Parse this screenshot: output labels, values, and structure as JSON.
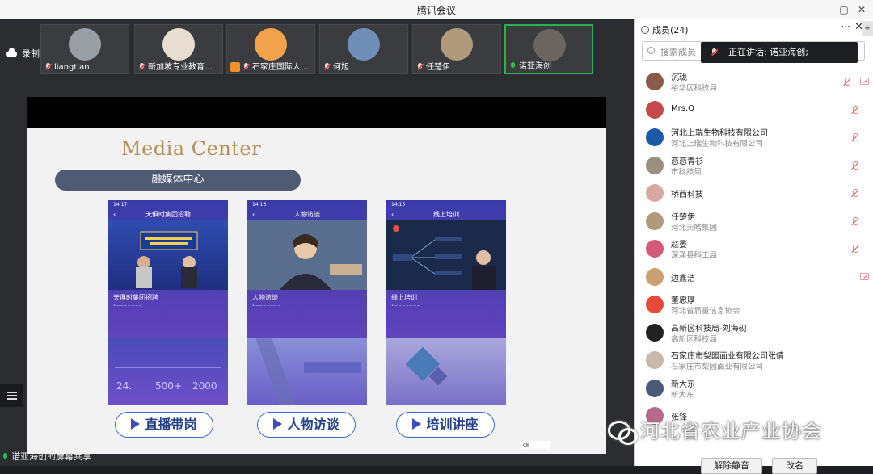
{
  "window": {
    "title": "腾讯会议",
    "controls": [
      "–",
      "▢",
      "✕"
    ]
  },
  "recording": {
    "label": "录制中"
  },
  "participants_strip": [
    {
      "name": "liangtian",
      "mic": "off",
      "avatar": "#9a9fa6"
    },
    {
      "name": "新加坡专业教育培...",
      "mic": "off",
      "avatar": "#e8ddd0"
    },
    {
      "name": "石家庄国际人才...",
      "mic": "off",
      "avatar": "#f2a24a",
      "badge": true
    },
    {
      "name": "何旭",
      "mic": "off",
      "avatar": "#6f8fb8"
    },
    {
      "name": "任楚伊",
      "mic": "off",
      "avatar": "#b09a7b"
    },
    {
      "name": "诺亚海创",
      "mic": "green",
      "avatar": "#6b6560",
      "active": true
    }
  ],
  "slide": {
    "title_en": "Media Center",
    "title_cn": "融媒体中心",
    "phones": [
      {
        "header": "天俱时集团招聘",
        "subtitle": "天俱时集团招聘",
        "time": "14:17",
        "hero": "#2d3b8f",
        "accent": "#f6d04a",
        "lower": "#4e44ba"
      },
      {
        "header": "人物访谈",
        "subtitle": "人物访谈",
        "time": "14:16",
        "hero": "#3e4d7a",
        "accent": "#ffffff",
        "lower": "#6d6fc0"
      },
      {
        "header": "线上培训",
        "subtitle": "线上培训",
        "time": "14:15",
        "hero": "#1d2e55",
        "accent": "#e74f3c",
        "lower": "#9a98d4"
      }
    ],
    "buttons": [
      "直播带岗",
      "人物访谈",
      "培训讲座"
    ]
  },
  "share": {
    "label": "诺亚海创的屏幕共享"
  },
  "ime": {
    "label": "ck"
  },
  "members_panel": {
    "header": "成员(24)",
    "more": "···",
    "close": "✕",
    "side_tab": "≡",
    "search_placeholder": "搜索成员",
    "speaking_label": "正在讲话: 诺亚海创;",
    "members": [
      {
        "name": "沉珑",
        "sub": "裕华区科技局",
        "avatar": "#8a5a4a",
        "mic": true,
        "cam": true
      },
      {
        "name": "Mrs.Q",
        "sub": "",
        "avatar": "#c54a4a",
        "mic": true,
        "cam": false
      },
      {
        "name": "河北上瑞生物科技有限公司",
        "sub": "河北上瑞生物科技有限公司",
        "avatar": "#1c5aa8",
        "mic": true,
        "cam": false
      },
      {
        "name": "恋恋青衫",
        "sub": "市科技局",
        "avatar": "#9a8f80",
        "mic": true,
        "cam": false
      },
      {
        "name": "桥西科技",
        "sub": "",
        "avatar": "#d7aaa0",
        "mic": true,
        "cam": false
      },
      {
        "name": "任楚伊",
        "sub": "河北天皓集团",
        "avatar": "#b09a7b",
        "mic": true,
        "cam": false
      },
      {
        "name": "赵晏",
        "sub": "深泽县科工局",
        "avatar": "#d45a7a",
        "mic": true,
        "cam": false
      },
      {
        "name": "边鑫洁",
        "sub": "",
        "avatar": "#c9a070",
        "mic": false,
        "cam": true
      },
      {
        "name": "董忠厚",
        "sub": "河北省质量信息协会",
        "avatar": "#e84a3a",
        "mic": false,
        "cam": false
      },
      {
        "name": "高新区科技局-刘海砚",
        "sub": "高新区科技局",
        "avatar": "#222222",
        "mic": false,
        "cam": false
      },
      {
        "name": "石家庄市梨园面业有限公司张倩",
        "sub": "石家庄市梨园面业有限公司",
        "avatar": "#c8b8a8",
        "mic": false,
        "cam": false
      },
      {
        "name": "新大东",
        "sub": "新大东",
        "avatar": "#4a5a7a",
        "mic": false,
        "cam": false
      },
      {
        "name": "张锋",
        "sub": "",
        "avatar": "#b86a8a",
        "mic": false,
        "cam": false
      }
    ],
    "footer_buttons": [
      "解除静音",
      "改名"
    ]
  },
  "watermark": {
    "text": "河北省农业产业协会"
  }
}
